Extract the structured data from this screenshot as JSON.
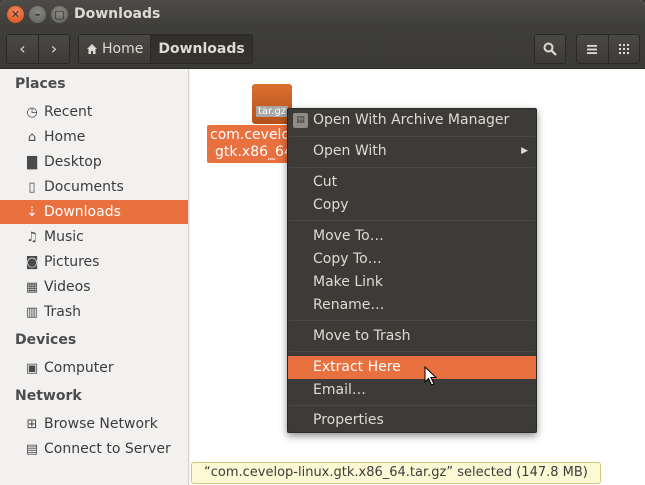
{
  "window": {
    "title": "Downloads"
  },
  "toolbar": {
    "back_icon": "‹",
    "forward_icon": "›",
    "breadcrumb_home": "Home",
    "breadcrumb_current": "Downloads"
  },
  "sidebar": {
    "sections": [
      {
        "title": "Places",
        "items": [
          "Recent",
          "Home",
          "Desktop",
          "Documents",
          "Downloads",
          "Music",
          "Pictures",
          "Videos",
          "Trash"
        ]
      },
      {
        "title": "Devices",
        "items": [
          "Computer"
        ]
      },
      {
        "title": "Network",
        "items": [
          "Browse Network",
          "Connect to Server"
        ]
      }
    ],
    "selected": "Downloads"
  },
  "file": {
    "icon_label": "tar.gz",
    "name_line1": "com.cevelo",
    "name_line2": "gtk.x86_64"
  },
  "context_menu": {
    "items": [
      "Open With Archive Manager",
      "Open With",
      "Cut",
      "Copy",
      "Move To…",
      "Copy To…",
      "Make Link",
      "Rename…",
      "Move to Trash",
      "Extract Here",
      "Email…",
      "Properties"
    ],
    "highlighted": "Extract Here"
  },
  "statusbar": {
    "text": "“com.cevelop-linux.gtk.x86_64.tar.gz” selected  (147.8 MB)"
  },
  "colors": {
    "accent": "#e9703f",
    "titlebar": "#3e3d39",
    "menu_bg": "#3c3b37"
  }
}
